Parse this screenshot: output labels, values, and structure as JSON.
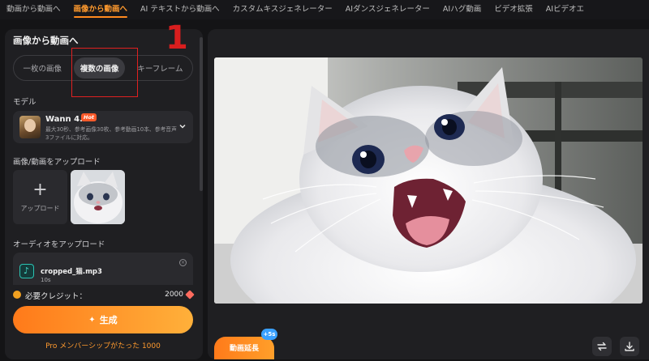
{
  "topnav": {
    "tabs": [
      {
        "label": "動画から動画へ",
        "active": false
      },
      {
        "label": "画像から動画へ",
        "active": true
      },
      {
        "label": "AI テキストから動画へ",
        "active": false
      },
      {
        "label": "カスタムキスジェネレーター",
        "active": false
      },
      {
        "label": "AIダンスジェネレーター",
        "active": false
      },
      {
        "label": "AIハグ動画",
        "active": false
      },
      {
        "label": "ビデオ拡張",
        "active": false
      },
      {
        "label": "AIビデオエ",
        "active": false
      }
    ]
  },
  "panel": {
    "title": "画像から動画へ",
    "mode_options": [
      "一枚の画像",
      "複数の画像",
      "キーフレーム"
    ],
    "active_mode": "複数の画像",
    "annotation_number": "1",
    "model_label": "モデル",
    "model": {
      "name": "Wann 4.0",
      "badge": "Hot",
      "description": "最大30秒、参考画像30枚、参考動画10本、参考音声3ファイルに対応。"
    },
    "upload_label": "画像/動画をアップロード",
    "upload_button_label": "アップロード",
    "audio_label": "オーディオをアップロード",
    "audio": {
      "filename": "cropped_猫.mp3",
      "duration": "10s"
    },
    "credits_label": "必要クレジット：",
    "credits_value": "2000",
    "generate_label": "生成",
    "pro_text": "Pro メンバーシップがたった 1000"
  },
  "preview": {
    "extend_label": "動画延長",
    "extend_badge": "+5s"
  },
  "colors": {
    "accent": "#ff8a1f",
    "background": "#141416",
    "panel": "#1f1f22",
    "annotation": "#e02020"
  }
}
